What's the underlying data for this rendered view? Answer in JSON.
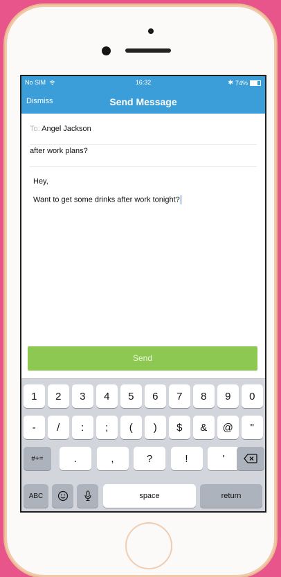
{
  "status": {
    "carrier": "No SIM",
    "time": "16:32",
    "battery": "74%",
    "battery_level": 0.74
  },
  "nav": {
    "dismiss": "Dismiss",
    "title": "Send Message"
  },
  "compose": {
    "to_label": "To:",
    "to_value": "Angel Jackson",
    "subject": "after work plans?",
    "body_line1": "Hey,",
    "body_line2": "Want to get some drinks after work tonight?"
  },
  "send_label": "Send",
  "keyboard": {
    "row1": [
      "1",
      "2",
      "3",
      "4",
      "5",
      "6",
      "7",
      "8",
      "9",
      "0"
    ],
    "row2": [
      "-",
      "/",
      ":",
      ";",
      "(",
      ")",
      "$",
      "&",
      "@",
      "\""
    ],
    "row3_left": "#+=",
    "row3": [
      ".",
      ",",
      "?",
      "!",
      "'"
    ],
    "abc": "ABC",
    "space": "space",
    "return": "return"
  },
  "colors": {
    "background": "#e8558a",
    "nav": "#3b9ed8",
    "send": "#8dc852"
  }
}
